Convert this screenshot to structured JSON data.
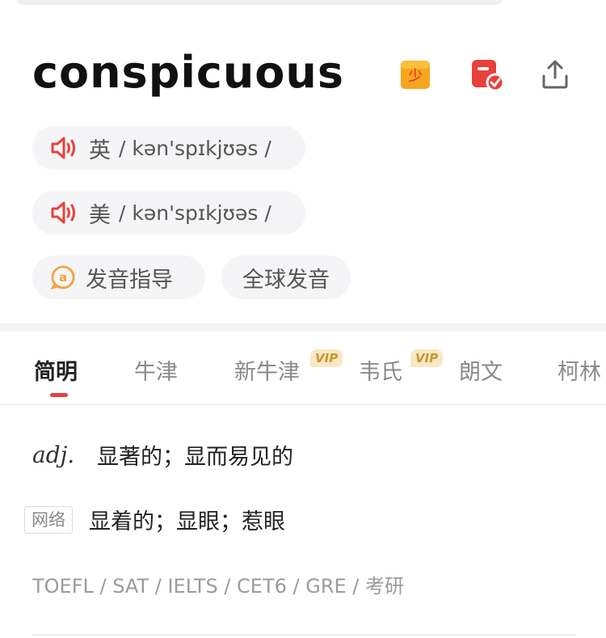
{
  "word": "conspicuous",
  "header_icons": {
    "kid": "kids-mode-icon",
    "note": "wordbook-icon",
    "share": "share-icon"
  },
  "pronunciation": {
    "uk": {
      "region": "英",
      "ipa": "/ kən'spɪkjʊəs /"
    },
    "us": {
      "region": "美",
      "ipa": "/ kən'spɪkjʊəs /"
    },
    "guide_label": "发音指导",
    "global_label": "全球发音"
  },
  "tabs": [
    {
      "label": "简明",
      "active": true
    },
    {
      "label": "牛津",
      "active": false
    },
    {
      "label": "新牛津",
      "active": false,
      "badge": "VIP"
    },
    {
      "label": "韦氏",
      "active": false,
      "badge": "VIP"
    },
    {
      "label": "朗文",
      "active": false
    },
    {
      "label": "柯林",
      "active": false
    }
  ],
  "definitions": [
    {
      "pos": "adj.",
      "text": "显著的；显而易见的"
    },
    {
      "pos": "网络",
      "text": "显着的；显眼；惹眼"
    }
  ],
  "exams": "TOEFL / SAT / IELTS / CET6 / GRE / 考研",
  "colors": {
    "accent": "#e8403a",
    "vip_bg": "#f7e9c4",
    "vip_text": "#c9962a",
    "kid_icon": "#f7a51e"
  }
}
